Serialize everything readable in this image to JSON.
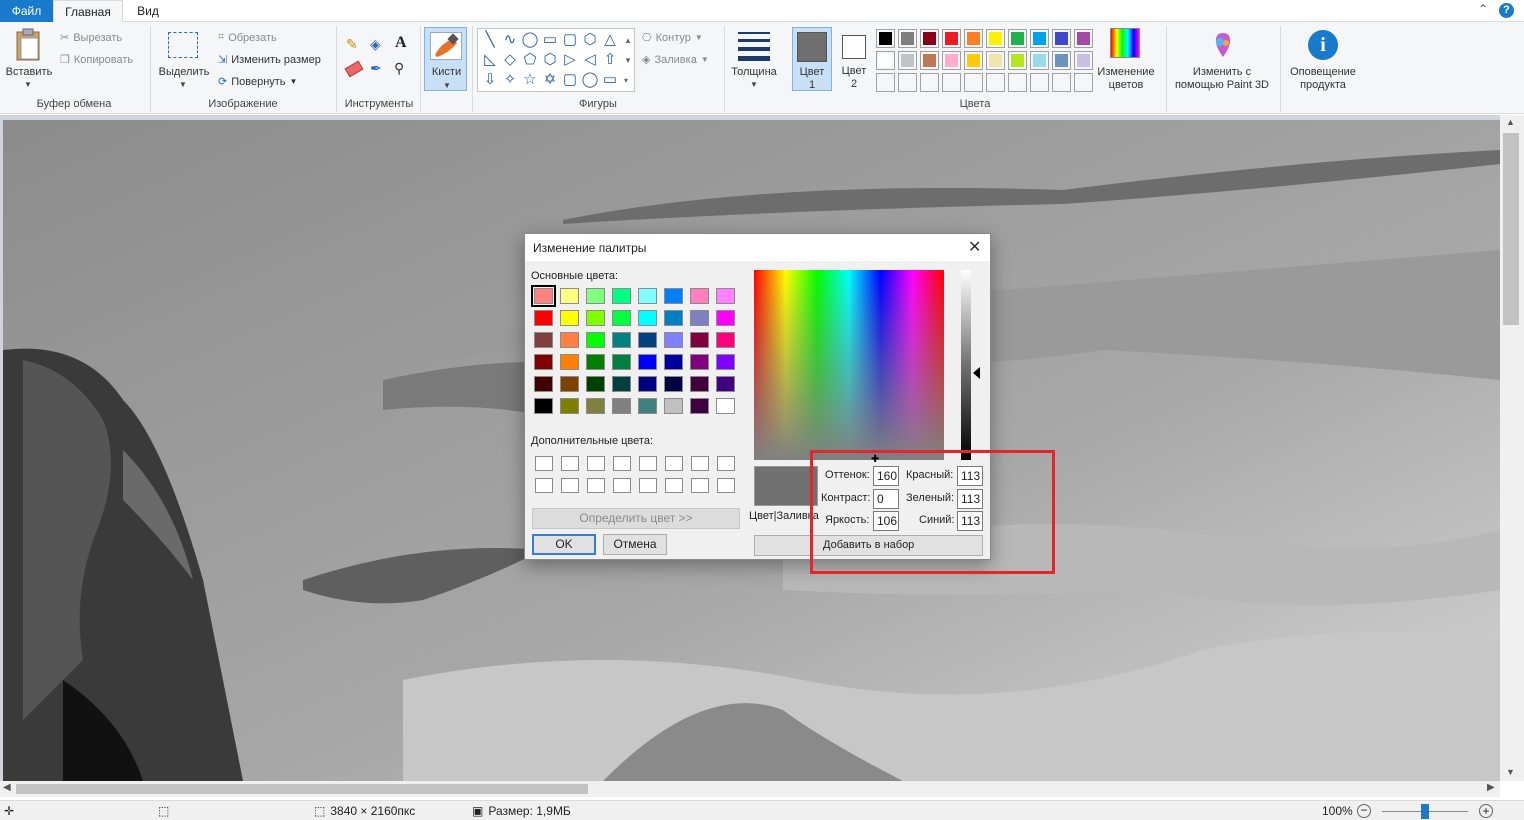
{
  "tabs": {
    "file": "Файл",
    "home": "Главная",
    "view": "Вид"
  },
  "clipboard": {
    "paste": "Вставить",
    "cut": "Вырезать",
    "copy": "Копировать",
    "group": "Буфер обмена"
  },
  "image": {
    "select": "Выделить",
    "crop": "Обрезать",
    "resize": "Изменить размер",
    "rotate": "Повернуть",
    "group": "Изображение"
  },
  "tools": {
    "group": "Инструменты",
    "text_glyph": "A"
  },
  "brushes": {
    "label": "Кисти"
  },
  "shapes": {
    "outline": "Контур",
    "fill": "Заливка",
    "group": "Фигуры",
    "glyphs": [
      "╲",
      "∿",
      "◯",
      "▭",
      "▢",
      "⬡",
      "△",
      "◺",
      "◇",
      "⬠",
      "⬡",
      "▷",
      "◁",
      "⇧",
      "⇩",
      "✧",
      "☆",
      "✡",
      "▢",
      "◯",
      "▭"
    ]
  },
  "size": {
    "label": "Толщина"
  },
  "color1": {
    "line1": "Цвет",
    "line2": "1",
    "swatch": "#6f6f6f"
  },
  "color2": {
    "line1": "Цвет",
    "line2": "2",
    "swatch": "#ffffff"
  },
  "colors": {
    "group": "Цвета",
    "row1": [
      "#000000",
      "#7f7f7f",
      "#880015",
      "#ed1c24",
      "#ff7f27",
      "#fff200",
      "#22b14c",
      "#00a2e8",
      "#3f48cc",
      "#a349a4"
    ],
    "row2": [
      "#ffffff",
      "#c3c3c3",
      "#b97a57",
      "#ffaec9",
      "#ffc90e",
      "#efe4b0",
      "#b5e61d",
      "#99d9ea",
      "#7092be",
      "#c8bfe7"
    ],
    "row3": [
      "#ffffff",
      "#ffffff",
      "#ffffff",
      "#ffffff",
      "#ffffff",
      "#ffffff",
      "#ffffff",
      "#ffffff",
      "#ffffff",
      "#ffffff"
    ],
    "edit_line1": "Изменение",
    "edit_line2": "цветов"
  },
  "paint3d": {
    "line1": "Изменить с",
    "line2": "помощью Paint 3D"
  },
  "notify": {
    "line1": "Оповещение",
    "line2": "продукта"
  },
  "dialog": {
    "title": "Изменение палитры",
    "basic_label": "Основные цвета:",
    "basic_colors": [
      "#ff8080",
      "#ffff80",
      "#80ff80",
      "#00ff80",
      "#80ffff",
      "#0080ff",
      "#ff80c0",
      "#ff80ff",
      "#ff0000",
      "#ffff00",
      "#80ff00",
      "#00ff40",
      "#00ffff",
      "#0080c0",
      "#8080c0",
      "#ff00ff",
      "#804040",
      "#ff8040",
      "#00ff00",
      "#008080",
      "#004080",
      "#8080ff",
      "#800040",
      "#ff0080",
      "#800000",
      "#ff8000",
      "#008000",
      "#008040",
      "#0000ff",
      "#0000a0",
      "#800080",
      "#8000ff",
      "#400000",
      "#804000",
      "#004000",
      "#004040",
      "#000080",
      "#000040",
      "#400040",
      "#400080",
      "#000000",
      "#808000",
      "#808040",
      "#808080",
      "#408080",
      "#c0c0c0",
      "#400040",
      "#ffffff"
    ],
    "custom_label": "Дополнительные цвета:",
    "define_button": "Определить цвет >>",
    "ok": "OK",
    "cancel": "Отмена",
    "preview_label": "Цвет|Заливка",
    "preview_color": "#717171",
    "hue_label": "Оттенок:",
    "hue": "160",
    "sat_label": "Контраст:",
    "sat": "0",
    "lum_label": "Яркость:",
    "lum": "106",
    "red_label": "Красный:",
    "red": "113",
    "green_label": "Зеленый:",
    "green": "113",
    "blue_label": "Синий:",
    "blue": "113",
    "add_button": "Добавить в набор"
  },
  "status": {
    "dimensions": "3840 × 2160пкс",
    "size": "Размер: 1,9МБ",
    "zoom": "100%"
  }
}
